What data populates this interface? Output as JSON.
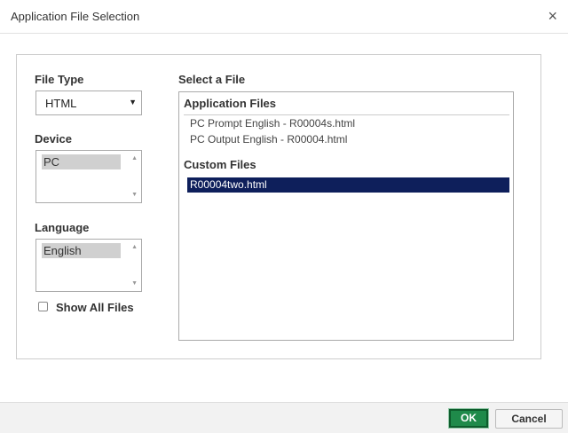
{
  "dialog": {
    "title": "Application File Selection",
    "close_glyph": "×"
  },
  "left": {
    "file_type_label": "File Type",
    "file_type_value": "HTML",
    "device_label": "Device",
    "device_options": [
      "PC"
    ],
    "language_label": "Language",
    "language_options": [
      "English"
    ],
    "show_all_label": "Show All Files",
    "show_all_checked": false
  },
  "files": {
    "header": "Select a File",
    "application_header": "Application Files",
    "application_files": [
      "PC Prompt English - R00004s.html",
      "PC Output English - R00004.html"
    ],
    "custom_header": "Custom Files",
    "custom_files": [
      "R00004two.html"
    ],
    "selected_color": "#0e1f5b"
  },
  "footer": {
    "ok_label": "OK",
    "cancel_label": "Cancel",
    "ok_color": "#1f8a4a"
  }
}
